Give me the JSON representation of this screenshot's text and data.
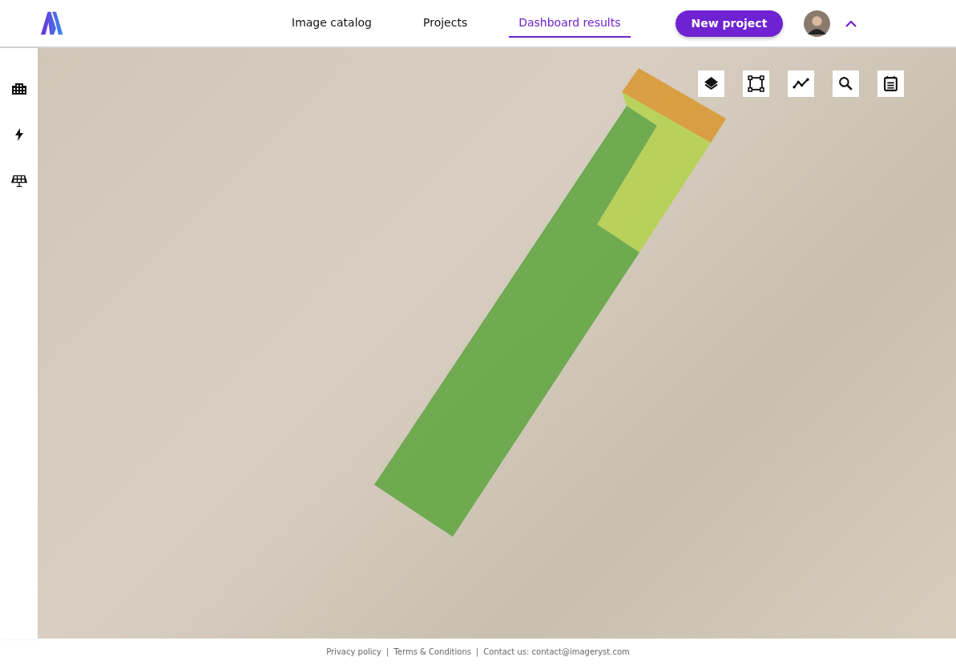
{
  "nav": {
    "tabs": [
      {
        "label": "Image catalog",
        "selected": false
      },
      {
        "label": "Projects",
        "selected": false
      },
      {
        "label": "Dashboard results",
        "selected": true
      }
    ],
    "new_button": "New project"
  },
  "footer": [
    {
      "kind": "link",
      "text": "Privacy policy"
    },
    {
      "kind": "separator",
      "text": "|"
    },
    {
      "kind": "link",
      "text": "Terms & Conditions"
    },
    {
      "kind": "separator",
      "text": "|"
    },
    {
      "kind": "text",
      "text": "Contact us: contact@imageryst.com"
    }
  ]
}
